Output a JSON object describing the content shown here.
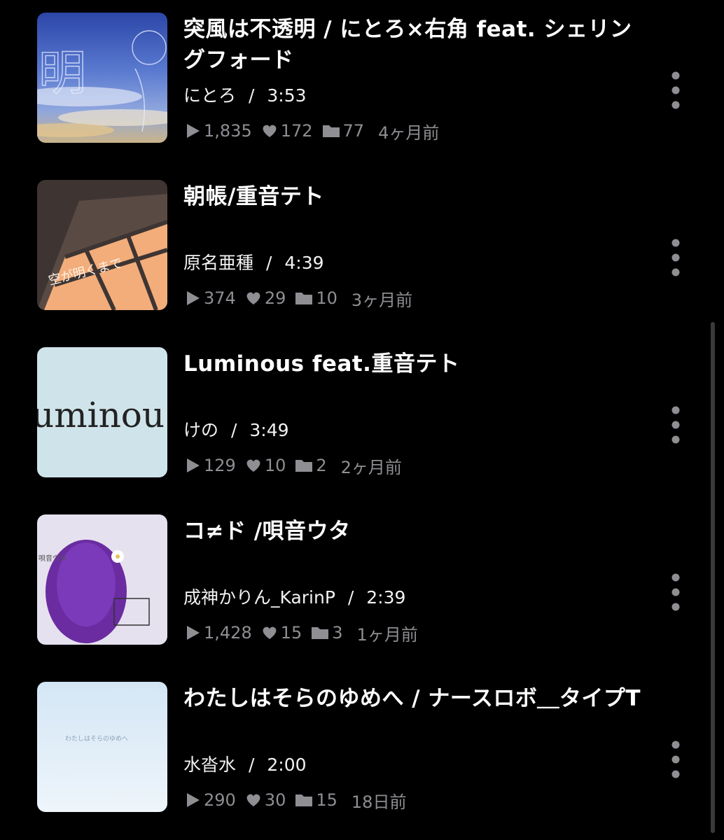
{
  "videos": [
    {
      "title": "突風は不透明 / にとろ×右角 feat. シェリングフォード",
      "author": "にとろ",
      "duration": "3:53",
      "plays": "1,835",
      "likes": "172",
      "mylists": "77",
      "posted": "4ヶ月前",
      "thumb_text": "明"
    },
    {
      "title": "朝帳/重音テト",
      "author": "原名亜種",
      "duration": "4:39",
      "plays": "374",
      "likes": "29",
      "mylists": "10",
      "posted": "3ヶ月前",
      "thumb_text": "空が明くまで"
    },
    {
      "title": "Luminous feat.重音テト",
      "author": "けの",
      "duration": "3:49",
      "plays": "129",
      "likes": "10",
      "mylists": "2",
      "posted": "2ヶ月前",
      "thumb_text": "uminou"
    },
    {
      "title": "コ≠ド /唄音ウタ",
      "author": "成神かりん_KarinP",
      "duration": "2:39",
      "plays": "1,428",
      "likes": "15",
      "mylists": "3",
      "posted": "1ヶ月前",
      "thumb_text": "唄音ウタ"
    },
    {
      "title": "わたしはそらのゆめへ / ナースロボ＿タイプT",
      "author": "水沓水",
      "duration": "2:00",
      "plays": "290",
      "likes": "30",
      "mylists": "15",
      "posted": "18日前",
      "thumb_text": "わたしはそらのゆめへ"
    }
  ],
  "meta_separator": "/",
  "icons": {
    "play": "play-icon",
    "like": "heart-icon",
    "mylist": "folder-icon",
    "more": "more-vertical-icon"
  },
  "colors": {
    "background": "#000000",
    "text": "#ffffff",
    "secondary": "#8e8e93"
  }
}
